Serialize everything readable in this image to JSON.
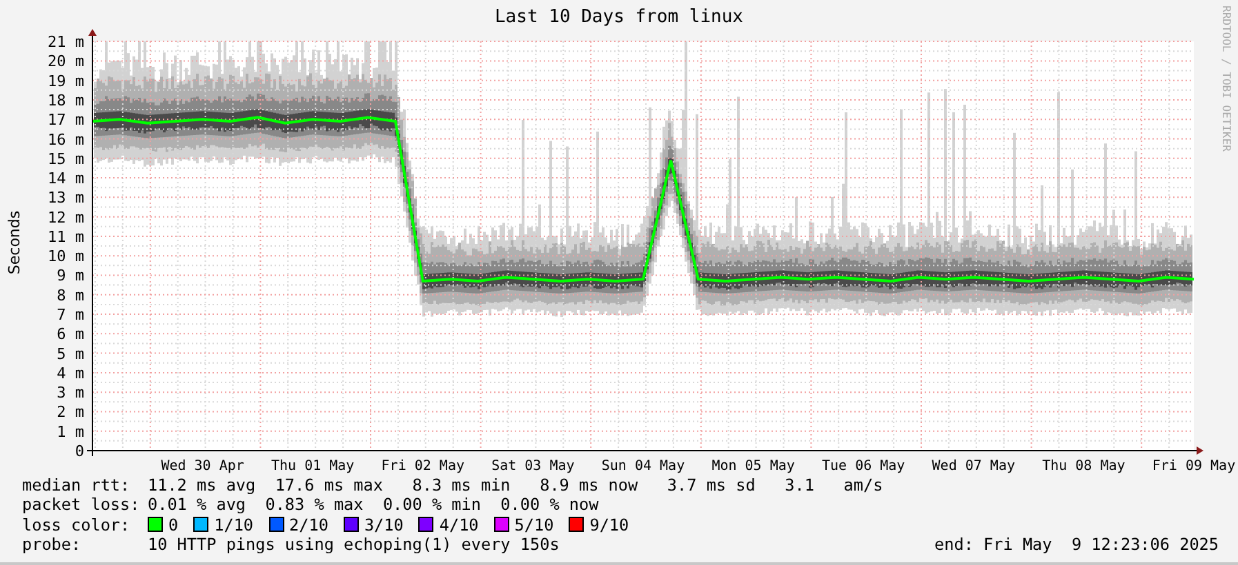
{
  "credit": "RRDTOOL / TOBI OETIKER",
  "chart": {
    "chart_data": {
      "type": "line",
      "title": "Last 10 Days from linux",
      "ylabel": "Seconds",
      "ylim": [
        0,
        21
      ],
      "grid": true,
      "categories": [
        null,
        null,
        null,
        null,
        "Wed 30 Apr",
        null,
        null,
        null,
        "Thu 01 May",
        null,
        null,
        null,
        "Fri 02 May",
        null,
        null,
        null,
        "Sat 03 May",
        null,
        null,
        null,
        "Sun 04 May",
        null,
        null,
        null,
        "Mon 05 May",
        null,
        null,
        null,
        "Tue 06 May",
        null,
        null,
        null,
        "Wed 07 May",
        null,
        null,
        null,
        "Thu 08 May",
        null,
        null,
        null,
        "Fri 09 May"
      ],
      "series": [
        {
          "color": "#00ff00",
          "values": [
            16.9,
            17.0,
            16.8,
            16.9,
            17.0,
            16.9,
            17.1,
            16.8,
            17.0,
            16.9,
            17.1,
            16.9,
            8.7,
            8.8,
            8.7,
            8.9,
            8.8,
            8.7,
            8.8,
            8.7,
            8.8,
            14.9,
            8.8,
            8.7,
            8.8,
            8.9,
            8.8,
            8.9,
            8.8,
            8.7,
            8.9,
            8.8,
            8.9,
            8.8,
            8.7,
            8.8,
            8.9,
            8.8,
            8.7,
            8.9,
            8.8
          ]
        }
      ],
      "yticks": [
        {
          "value": 0,
          "label": "0"
        },
        {
          "value": 1,
          "label": "1 m"
        },
        {
          "value": 2,
          "label": "2 m"
        },
        {
          "value": 3,
          "label": "3 m"
        },
        {
          "value": 4,
          "label": "4 m"
        },
        {
          "value": 5,
          "label": "5 m"
        },
        {
          "value": 6,
          "label": "6 m"
        },
        {
          "value": 7,
          "label": "7 m"
        },
        {
          "value": 8,
          "label": "8 m"
        },
        {
          "value": 9,
          "label": "9 m"
        },
        {
          "value": 10,
          "label": "10 m"
        },
        {
          "value": 11,
          "label": "11 m"
        },
        {
          "value": 12,
          "label": "12 m"
        },
        {
          "value": 13,
          "label": "13 m"
        },
        {
          "value": 14,
          "label": "14 m"
        },
        {
          "value": 15,
          "label": "15 m"
        },
        {
          "value": 16,
          "label": "16 m"
        },
        {
          "value": 17,
          "label": "17 m"
        },
        {
          "value": 18,
          "label": "18 m"
        },
        {
          "value": 19,
          "label": "19 m"
        },
        {
          "value": 20,
          "label": "20 m"
        },
        {
          "value": 21,
          "label": "21 m"
        }
      ]
    }
  },
  "legend": {
    "median_rtt": {
      "label": "median rtt:",
      "text": "11.2 ms avg  17.6 ms max   8.3 ms min   8.9 ms now   3.7 ms sd   3.1   am/s"
    },
    "packet_loss": {
      "label": "packet loss:",
      "text": "0.01 % avg  0.83 % max  0.00 % min  0.00 % now"
    },
    "loss_color": {
      "label": "loss color:",
      "items": [
        {
          "label": "0",
          "color": "#00ff00"
        },
        {
          "label": "1/10",
          "color": "#00b8ff"
        },
        {
          "label": "2/10",
          "color": "#0059ff"
        },
        {
          "label": "3/10",
          "color": "#5e00ff"
        },
        {
          "label": "4/10",
          "color": "#7e00ff"
        },
        {
          "label": "5/10",
          "color": "#dd00ff"
        },
        {
          "label": "9/10",
          "color": "#ff0000"
        }
      ]
    },
    "probe": {
      "label": "probe:",
      "text": "10 HTTP pings using echoping(1) every 150s"
    },
    "end": "end: Fri May  9 12:23:06 2025"
  }
}
